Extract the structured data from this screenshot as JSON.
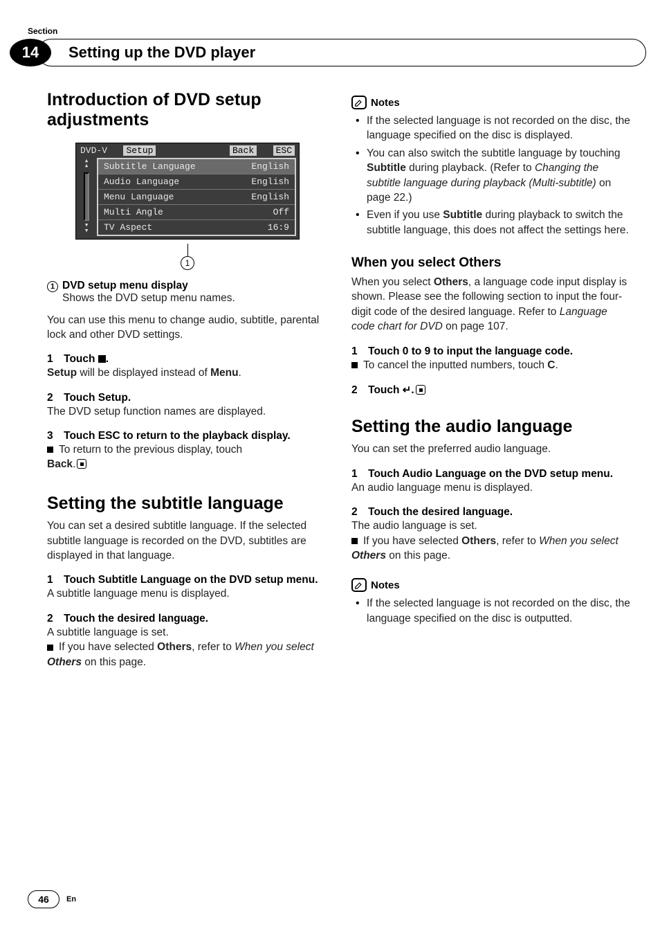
{
  "section_label": "Section",
  "chapter_number": "14",
  "chapter_title": "Setting up the DVD player",
  "page_number": "46",
  "lang_abbr": "En",
  "dvd_screenshot": {
    "top_left": "DVD-V",
    "top_tab": "Setup",
    "top_back": "Back",
    "top_esc": "ESC",
    "rows": [
      {
        "label": "Subtitle Language",
        "value": "English",
        "selected": true
      },
      {
        "label": "Audio Language",
        "value": "English",
        "selected": false
      },
      {
        "label": "Menu Language",
        "value": "English",
        "selected": false
      },
      {
        "label": "Multi Angle",
        "value": "Off",
        "selected": false
      },
      {
        "label": "TV Aspect",
        "value": "16:9",
        "selected": false
      }
    ],
    "callout_num": "1"
  },
  "left": {
    "h1": "Introduction of DVD setup adjustments",
    "cap1_num": "1",
    "cap1_title": "DVD setup menu display",
    "cap1_body": "Shows the DVD setup menu names.",
    "intro_body": "You can use this menu to change audio, subtitle, parental lock and other DVD settings.",
    "s1_head_pre": "1 Touch ",
    "s1_head_post": ".",
    "s1_body_pre": "Setup",
    "s1_body_mid": " will be displayed instead of ",
    "s1_body_post": "Menu",
    "s2_head": "2 Touch Setup.",
    "s2_body": "The DVD setup function names are displayed.",
    "s3_head": "3 Touch ESC to return to the playback display.",
    "s3_bullet": "To return to the previous display, touch",
    "s3_back": "Back",
    "h1b": "Setting the subtitle language",
    "b_intro": "You can set a desired subtitle language. If the selected subtitle language is recorded on the DVD, subtitles are displayed in that language.",
    "b_s1_head": "1 Touch Subtitle Language on the DVD setup menu.",
    "b_s1_body": "A subtitle language menu is displayed.",
    "b_s2_head": "2 Touch the desired language.",
    "b_s2_body": "A subtitle language is set.",
    "b_s2_bullet_pre": "If you have selected ",
    "b_s2_bullet_others": "Others",
    "b_s2_bullet_mid": ", refer to ",
    "b_s2_bullet_ital": "When you select ",
    "b_s2_bullet_post": " on this page."
  },
  "right": {
    "notes_label": "Notes",
    "n1": "If the selected language is not recorded on the disc, the language specified on the disc is displayed.",
    "n2_pre": "You can also switch the subtitle language by touching ",
    "n2_sub": "Subtitle",
    "n2_mid": " during playback. (Refer to ",
    "n2_ital": "Changing the subtitle language during playback (Multi-subtitle)",
    "n2_post": " on page 22.)",
    "n3_pre": "Even if you use ",
    "n3_sub": "Subtitle",
    "n3_post": " during playback to switch the subtitle language, this does not affect the settings here.",
    "h2_pre": "When you select ",
    "h2_others": "Others",
    "others_body_pre": "When you select ",
    "others_body_others": "Others",
    "others_body_mid": ", a language code input display is shown. Please see the following section to input the four-digit code of the desired language. Refer to ",
    "others_body_ital": "Language code chart for DVD",
    "others_body_post": " on page 107.",
    "o_s1_head": "1 Touch 0 to 9 to input the language code.",
    "o_s1_bullet_pre": "To cancel the inputted numbers, touch ",
    "o_s1_bullet_c": "C",
    "o_s2_head_pre": "2 Touch ",
    "o_s2_head_post": ".",
    "h1c": "Setting the audio language",
    "c_intro": "You can set the preferred audio language.",
    "c_s1_head": "1 Touch Audio Language on the DVD setup menu.",
    "c_s1_body": "An audio language menu is displayed.",
    "c_s2_head": "2 Touch the desired language.",
    "c_s2_body": "The audio language is set.",
    "c_s2_bullet_pre": "If you have selected ",
    "c_s2_bullet_others": "Others",
    "c_s2_bullet_mid": ", refer to ",
    "c_s2_bullet_ital": "When you select ",
    "c_s2_bullet_post": " on this page.",
    "notes2_label": "Notes",
    "n4": "If the selected language is not recorded on the disc, the language specified on the disc is outputted."
  }
}
